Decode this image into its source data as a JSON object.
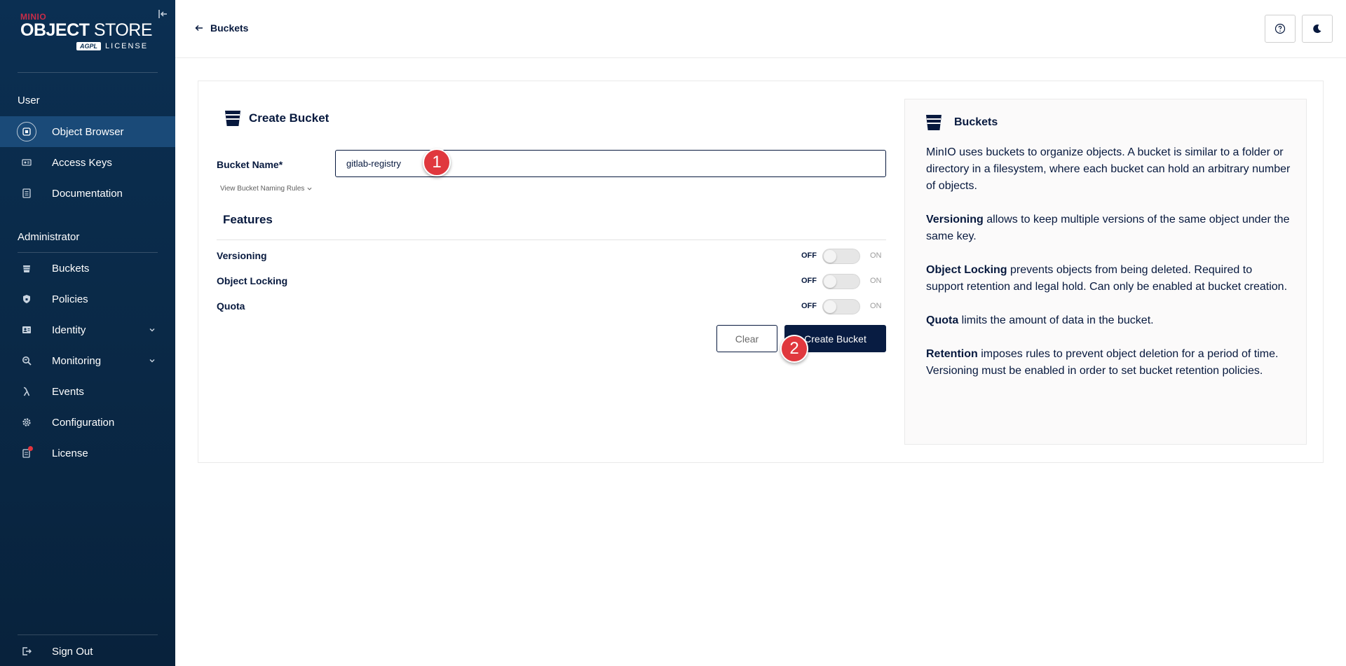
{
  "sidebar": {
    "logo": {
      "brand": "MINIO",
      "title_bold": "OBJECT",
      "title_thin": " STORE",
      "badge": "AGPL",
      "license_word": "LICENSE"
    },
    "user_section": "User",
    "user_items": [
      {
        "label": "Object Browser",
        "icon": "object-browser-icon",
        "active": true
      },
      {
        "label": "Access Keys",
        "icon": "access-keys-icon"
      },
      {
        "label": "Documentation",
        "icon": "documentation-icon"
      }
    ],
    "admin_section": "Administrator",
    "admin_items": [
      {
        "label": "Buckets",
        "icon": "bucket-icon"
      },
      {
        "label": "Policies",
        "icon": "policies-icon"
      },
      {
        "label": "Identity",
        "icon": "identity-icon",
        "expandable": true
      },
      {
        "label": "Monitoring",
        "icon": "monitoring-icon",
        "expandable": true
      },
      {
        "label": "Events",
        "icon": "lambda-icon"
      },
      {
        "label": "Configuration",
        "icon": "gear-icon"
      },
      {
        "label": "License",
        "icon": "license-icon",
        "notification": true
      }
    ],
    "sign_out": "Sign Out"
  },
  "header": {
    "back_label": "Buckets",
    "help_icon": "help-icon",
    "theme_icon": "moon-icon"
  },
  "form": {
    "title": "Create Bucket",
    "bucket_name_label": "Bucket Name*",
    "bucket_name_value": "gitlab-registry",
    "naming_rules": "View Bucket Naming Rules",
    "features_title": "Features",
    "features": [
      {
        "label": "Versioning",
        "off": "OFF",
        "on": "ON",
        "enabled": false
      },
      {
        "label": "Object Locking",
        "off": "OFF",
        "on": "ON",
        "enabled": false
      },
      {
        "label": "Quota",
        "off": "OFF",
        "on": "ON",
        "enabled": false
      }
    ],
    "clear_label": "Clear",
    "create_label": "Create Bucket"
  },
  "markers": [
    "1",
    "2"
  ],
  "help": {
    "title": "Buckets",
    "p1": "MinIO uses buckets to organize objects. A bucket is similar to a folder or directory in a filesystem, where each bucket can hold an arbitrary number of objects.",
    "p2_bold": "Versioning",
    "p2": " allows to keep multiple versions of the same object under the same key.",
    "p3_bold": "Object Locking",
    "p3": " prevents objects from being deleted. Required to support retention and legal hold. Can only be enabled at bucket creation.",
    "p4_bold": "Quota",
    "p4": " limits the amount of data in the bucket.",
    "p5_bold": "Retention",
    "p5": " imposes rules to prevent object deletion for a period of time. Versioning must be enabled in order to set bucket retention policies."
  },
  "colors": {
    "sidebar": "#0b2f52",
    "primary": "#081c42",
    "marker": "#e0383e"
  }
}
